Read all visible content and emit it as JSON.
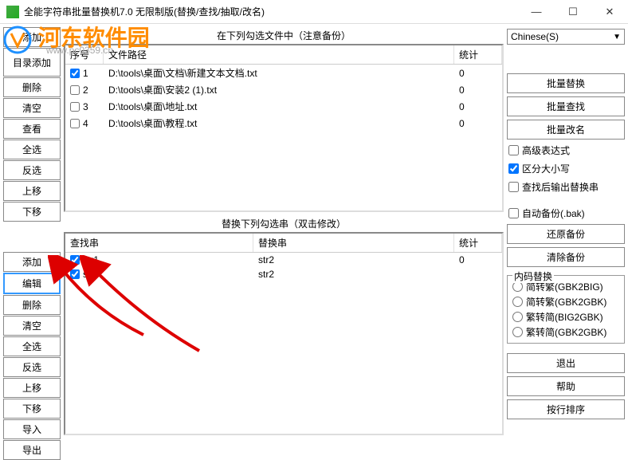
{
  "window": {
    "title": "全能字符串批量替换机7.0 无限制版(替换/查找/抽取/改名)",
    "minimize": "—",
    "maximize": "☐",
    "close": "✕"
  },
  "watermark": {
    "text": "河东软件园",
    "sub": "www.pc0359.cn"
  },
  "leftUpper": {
    "add": "添加",
    "addDir": "目录添加",
    "delete": "删除",
    "clear": "清空",
    "view": "查看",
    "selectAll": "全选",
    "invert": "反选",
    "moveUp": "上移",
    "moveDown": "下移"
  },
  "leftLower": {
    "add": "添加",
    "edit": "编辑",
    "delete": "删除",
    "clear": "清空",
    "selectAll": "全选",
    "invert": "反选",
    "moveUp": "上移",
    "moveDown": "下移",
    "import": "导入",
    "export": "导出"
  },
  "fileList": {
    "title": "在下列勾选文件中（注意备份）",
    "colSeq": "序号",
    "colPath": "文件路径",
    "colStat": "统计",
    "rows": [
      {
        "seq": "1",
        "checked": true,
        "path": "D:\\tools\\桌面\\文档\\新建文本文档.txt",
        "stat": "0"
      },
      {
        "seq": "2",
        "checked": false,
        "path": "D:\\tools\\桌面\\安装2 (1).txt",
        "stat": "0"
      },
      {
        "seq": "3",
        "checked": false,
        "path": "D:\\tools\\桌面\\地址.txt",
        "stat": "0"
      },
      {
        "seq": "4",
        "checked": false,
        "path": "D:\\tools\\桌面\\教程.txt",
        "stat": "0"
      }
    ]
  },
  "stringList": {
    "title": "替换下列勾选串（双击修改）",
    "colFind": "查找串",
    "colRepl": "替换串",
    "colStat": "统计",
    "rows": [
      {
        "checked": true,
        "find": "str1",
        "repl": "str2",
        "stat": "0"
      },
      {
        "checked": true,
        "find": "str1",
        "repl": "str2",
        "stat": ""
      }
    ]
  },
  "right": {
    "language": "Chinese(S)",
    "batchReplace": "批量替换",
    "batchFind": "批量查找",
    "batchRename": "批量改名",
    "advExpr": "高级表达式",
    "caseSensitive": "区分大小写",
    "outputAfterFind": "查找后输出替换串",
    "autoBackup": "自动备份(.bak)",
    "restoreBackup": "还原备份",
    "clearBackup": "清除备份",
    "encodingGroup": "内码替换",
    "enc1": "简转繁(GBK2BIG)",
    "enc2": "简转繁(GBK2GBK)",
    "enc3": "繁转简(BIG2GBK)",
    "enc4": "繁转简(GBK2GBK)",
    "exit": "退出",
    "help": "帮助",
    "sortByLine": "按行排序"
  }
}
